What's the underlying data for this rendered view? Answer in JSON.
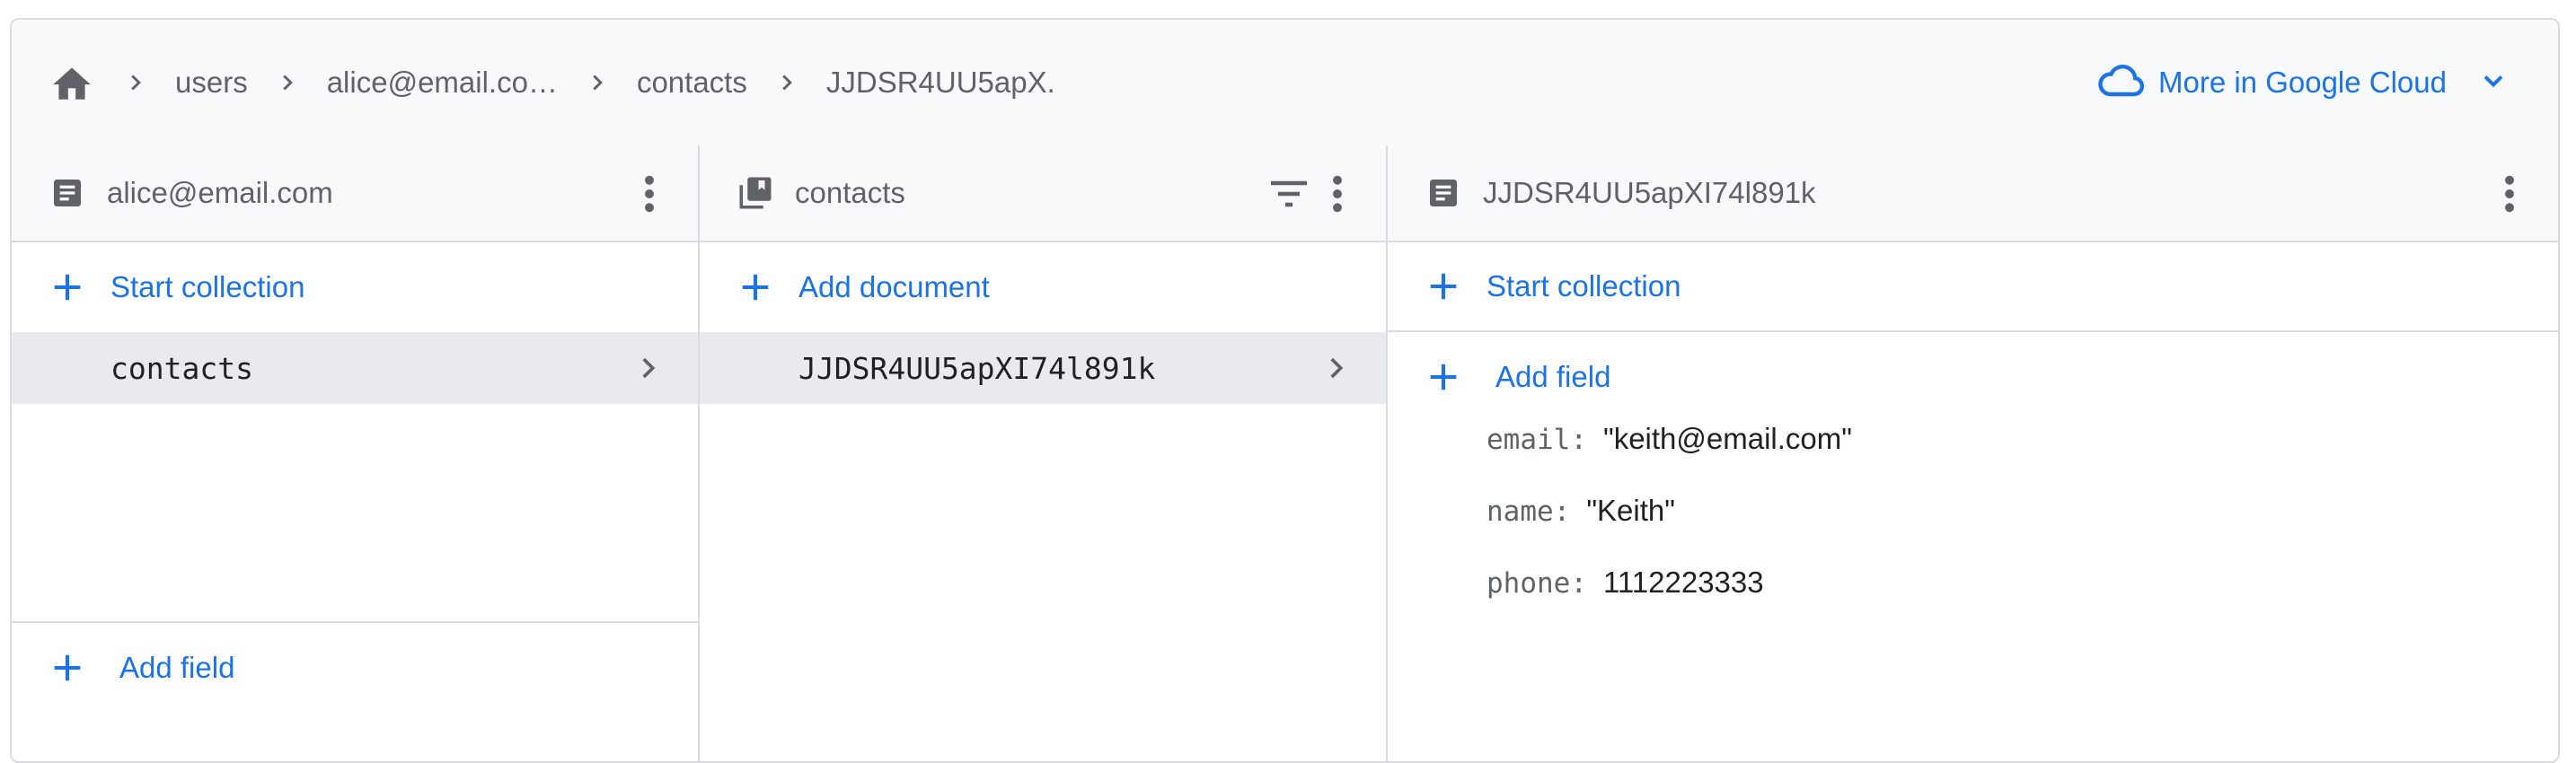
{
  "breadcrumb": {
    "items": [
      "users",
      "alice@email.co…",
      "contacts",
      "JJDSR4UU5apX."
    ]
  },
  "cloud_link": {
    "label": "More in Google Cloud"
  },
  "panels": {
    "document": {
      "title": "alice@email.com",
      "start_collection": "Start collection",
      "selected_collection": "contacts",
      "add_field": "Add field"
    },
    "collection": {
      "title": "contacts",
      "add_document": "Add document",
      "selected_document": "JJDSR4UU5apXI74l891k"
    },
    "detail": {
      "title": "JJDSR4UU5apXI74l891k",
      "start_collection": "Start collection",
      "add_field": "Add field",
      "fields": [
        {
          "key": "email:",
          "value": "\"keith@email.com\""
        },
        {
          "key": "name:",
          "value": "\"Keith\""
        },
        {
          "key": "phone:",
          "value": "1112223333"
        }
      ]
    }
  },
  "colors": {
    "accent": "#1a73e8",
    "icon": "#5f6368",
    "border": "#dadce0",
    "selected": "#e8eaed"
  },
  "icons": [
    "home-icon",
    "chevron-right-icon",
    "cloud-icon",
    "chevron-down-icon",
    "document-icon",
    "collection-icon",
    "filter-icon",
    "more-vert-icon",
    "plus-icon"
  ]
}
